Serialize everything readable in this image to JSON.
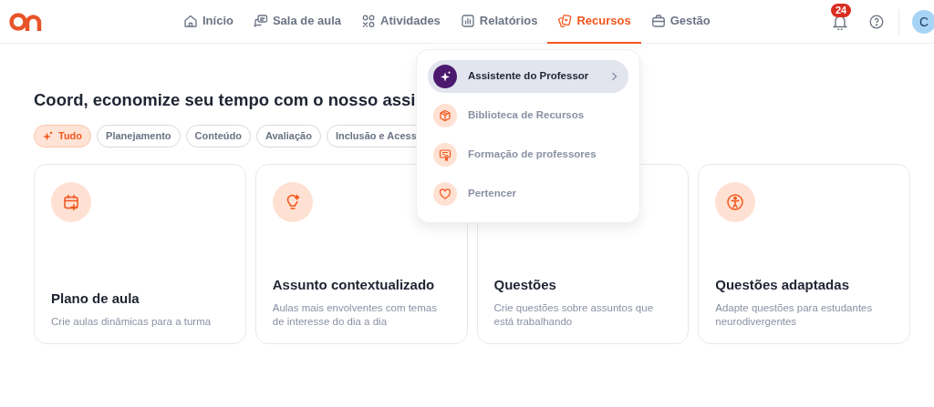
{
  "nav": [
    {
      "label": "Início",
      "selected": false
    },
    {
      "label": "Sala de aula",
      "selected": false
    },
    {
      "label": "Atividades",
      "selected": false
    },
    {
      "label": "Relatórios",
      "selected": false
    },
    {
      "label": "Recursos",
      "selected": true
    },
    {
      "label": "Gestão",
      "selected": false
    }
  ],
  "notifications": {
    "count": "24"
  },
  "avatar": {
    "initial": "C"
  },
  "heading": "Coord, economize seu tempo com o nosso assi",
  "filters": [
    {
      "label": "Tudo",
      "selected": true
    },
    {
      "label": "Planejamento",
      "selected": false
    },
    {
      "label": "Conteúdo",
      "selected": false
    },
    {
      "label": "Avaliação",
      "selected": false
    },
    {
      "label": "Inclusão e Acess",
      "selected": false
    }
  ],
  "cards": [
    {
      "title": "Plano de aula",
      "description": "Crie aulas dinâmicas para a turma"
    },
    {
      "title": "Assunto contextualizado",
      "description": "Aulas mais envolventes com temas de interesse do dia a dia"
    },
    {
      "title": "Questões",
      "description": "Crie questões sobre assuntos que está trabalhando"
    },
    {
      "title": "Questões adaptadas",
      "description": "Adapte questões para estudantes neurodivergentes"
    }
  ],
  "menu": [
    {
      "label": "Assistente do Professor",
      "selected": true
    },
    {
      "label": "Biblioteca de Recursos",
      "selected": false
    },
    {
      "label": "Formação de professores",
      "selected": false
    },
    {
      "label": "Pertencer",
      "selected": false
    }
  ]
}
